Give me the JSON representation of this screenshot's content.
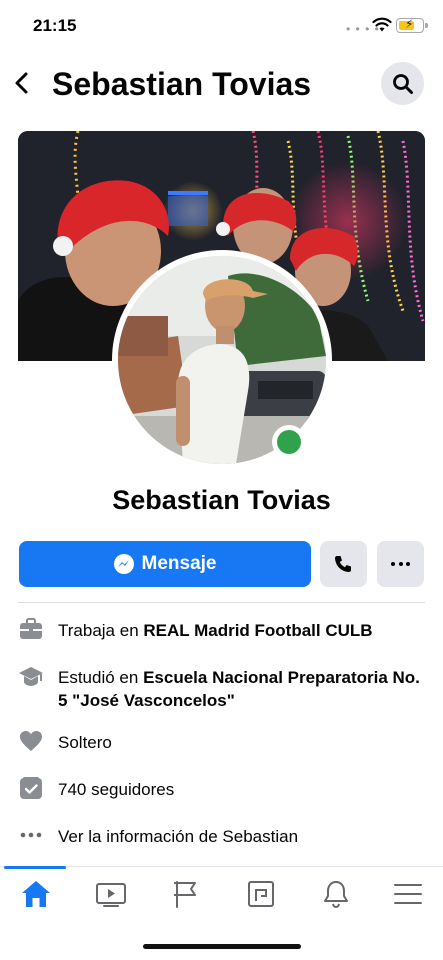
{
  "status_bar": {
    "time": "21:15"
  },
  "header": {
    "title": "Sebastian Tovias"
  },
  "profile": {
    "name": "Sebastian Tovias",
    "online": true
  },
  "actions": {
    "message_label": "Mensaje"
  },
  "info": {
    "work": {
      "prefix": "Trabaja en",
      "value": "REAL Madrid Football CULB"
    },
    "education": {
      "prefix": "Estudió en",
      "value": "Escuela Nacional Preparatoria No. 5 \"José Vasconcelos\""
    },
    "relationship": "Soltero",
    "followers": "740 seguidores",
    "more_info": "Ver la información de Sebastian"
  },
  "nav": {
    "items": [
      "home-icon",
      "video-icon",
      "pages-icon",
      "marketplace-icon",
      "notifications-icon",
      "menu-icon"
    ],
    "active": "home-icon"
  },
  "colors": {
    "accent": "#1877f2",
    "online": "#31a24c",
    "button_gray": "#e4e6eb"
  }
}
